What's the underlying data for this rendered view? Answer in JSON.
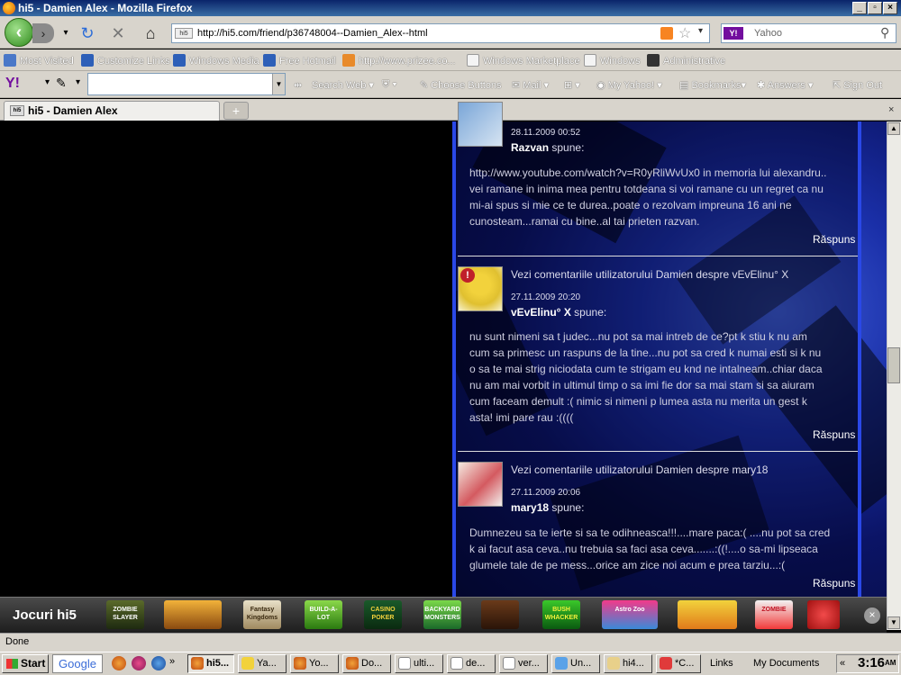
{
  "window": {
    "title": "hi5 - Damien Alex - Mozilla Firefox",
    "min": "_",
    "max": "▫",
    "close": "×"
  },
  "nav": {
    "url": "http://hi5.com/friend/p36748004--Damien_Alex--html",
    "search_placeholder": "Yahoo",
    "yahoo_badge": "Y!",
    "site_badge": "hi5"
  },
  "bookmarks": [
    "Most Visited",
    "Customize Links",
    "Windows Media",
    "Free Hotmail",
    "http://www.prizee.co...",
    "Windows Marketplace",
    "Windows",
    "Administrative"
  ],
  "yahoo_toolbar": {
    "logo": "Y!",
    "items": [
      "Search Web",
      "Choose Buttons",
      "Mail",
      "My Yahoo!",
      "Bookmarks",
      "Answers",
      "Sign Out"
    ]
  },
  "tab": {
    "title": "hi5 - Damien Alex",
    "new_tab": "+",
    "close": "×"
  },
  "comments": [
    {
      "header": "",
      "date": "28.11.2009 00:52",
      "author": "Razvan",
      "verb": "spune:",
      "lines": [
        "http://www.youtube.com/watch?v=R0yRliWvUx0 in memoria lui alexandru..",
        "vei ramane in inima mea pentru totdeana si voi ramane cu un regret ca nu",
        "mi-ai spus si mie ce te durea..poate o rezolvam impreuna 16 ani ne",
        "cunosteam...ramai cu bine..al tai prieten razvan."
      ],
      "reply": "Răspuns"
    },
    {
      "header": "Vezi comentariile utilizatorului Damien despre vEvElinu° X",
      "date": "27.11.2009 20:20",
      "author": "vEvElinu° X",
      "verb": "spune:",
      "lines": [
        "nu sunt nimeni sa t judec...nu pot sa mai intreb de ce?pt k stiu k nu am",
        "cum sa primesc un raspuns de la tine...nu pot sa cred k numai esti si k nu",
        "o sa te mai strig niciodata cum te strigam eu knd ne intalneam..chiar daca",
        "nu am mai vorbit in ultimul timp o sa imi fie dor sa mai stam si sa aiuram",
        "cum faceam demult :( nimic si nimeni p lumea asta nu merita un gest k",
        "asta! imi pare rau :(((("
      ],
      "reply": "Răspuns"
    },
    {
      "header": "Vezi comentariile utilizatorului Damien despre mary18",
      "date": "27.11.2009 20:06",
      "author": "mary18",
      "verb": "spune:",
      "lines": [
        "Dumnezeu sa te ierte si sa te odihneasca!!!....mare paca:( ....nu pot sa cred",
        "k ai facut asa ceva..nu trebuia sa faci asa ceva.......:((!....o sa-mi lipseaca",
        "glumele tale de pe mess...orice am zice noi acum e prea tarziu...:("
      ],
      "reply": "Răspuns"
    }
  ],
  "games": {
    "title": "Jocuri hi5",
    "items": [
      "ZOMBIE SLAYER",
      "",
      "Fantasy Kingdoms",
      "BUILD-A-LOT",
      "CASINO POKER",
      "BACKYARD MONSTERS",
      "",
      "BUSH WHACKER",
      "Astro Zoo",
      "",
      "ZOMBIE",
      ""
    ]
  },
  "status": {
    "text": "Done"
  },
  "taskbar": {
    "start": "Start",
    "google": "Google",
    "tasks": [
      "hi5...",
      "Ya...",
      "Yo...",
      "Do...",
      "ulti...",
      "de...",
      "ver...",
      "Un...",
      "hi4...",
      "*C..."
    ],
    "links": "Links",
    "my_documents": "My Documents",
    "clock": "3:16",
    "clock_ampm": "AM"
  }
}
